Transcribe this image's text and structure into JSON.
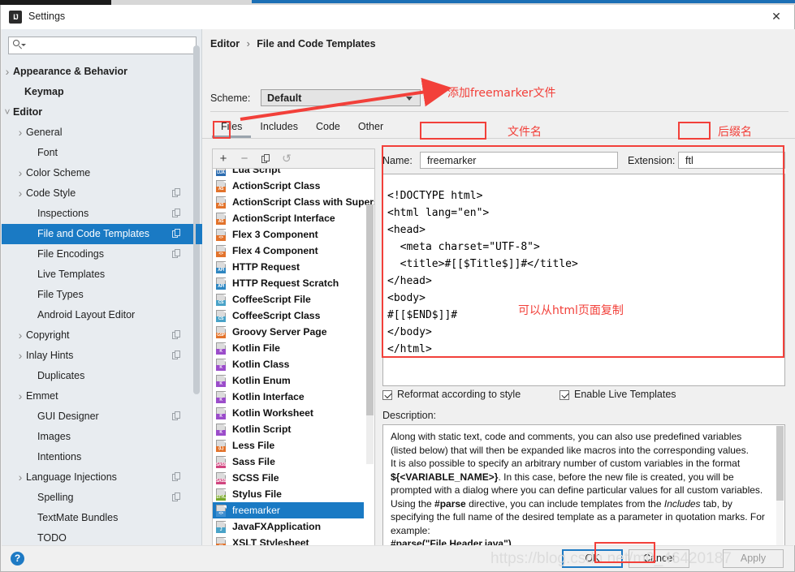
{
  "window": {
    "title": "Settings",
    "app_icon": "intellij-idea-icon",
    "close_icon": "close-icon"
  },
  "sidebar": {
    "search": {
      "placeholder": "",
      "value": "",
      "icon": "search-icon"
    },
    "items": [
      {
        "label": "Appearance & Behavior",
        "arrow": "closed",
        "bold": true,
        "indent": 14,
        "copy": false,
        "selected": false
      },
      {
        "label": "Keymap",
        "arrow": "none",
        "bold": true,
        "indent": 28,
        "copy": false,
        "selected": false
      },
      {
        "label": "Editor",
        "arrow": "open",
        "bold": true,
        "indent": 14,
        "copy": false,
        "selected": false
      },
      {
        "label": "General",
        "arrow": "closed",
        "bold": false,
        "indent": 30,
        "copy": false,
        "selected": false
      },
      {
        "label": "Font",
        "arrow": "none",
        "bold": false,
        "indent": 44,
        "copy": false,
        "selected": false
      },
      {
        "label": "Color Scheme",
        "arrow": "closed",
        "bold": false,
        "indent": 30,
        "copy": false,
        "selected": false
      },
      {
        "label": "Code Style",
        "arrow": "closed",
        "bold": false,
        "indent": 30,
        "copy": true,
        "selected": false
      },
      {
        "label": "Inspections",
        "arrow": "none",
        "bold": false,
        "indent": 44,
        "copy": true,
        "selected": false
      },
      {
        "label": "File and Code Templates",
        "arrow": "none",
        "bold": false,
        "indent": 44,
        "copy": true,
        "selected": true
      },
      {
        "label": "File Encodings",
        "arrow": "none",
        "bold": false,
        "indent": 44,
        "copy": true,
        "selected": false
      },
      {
        "label": "Live Templates",
        "arrow": "none",
        "bold": false,
        "indent": 44,
        "copy": false,
        "selected": false
      },
      {
        "label": "File Types",
        "arrow": "none",
        "bold": false,
        "indent": 44,
        "copy": false,
        "selected": false
      },
      {
        "label": "Android Layout Editor",
        "arrow": "none",
        "bold": false,
        "indent": 44,
        "copy": false,
        "selected": false
      },
      {
        "label": "Copyright",
        "arrow": "closed",
        "bold": false,
        "indent": 30,
        "copy": true,
        "selected": false
      },
      {
        "label": "Inlay Hints",
        "arrow": "closed",
        "bold": false,
        "indent": 30,
        "copy": true,
        "selected": false
      },
      {
        "label": "Duplicates",
        "arrow": "none",
        "bold": false,
        "indent": 44,
        "copy": false,
        "selected": false
      },
      {
        "label": "Emmet",
        "arrow": "closed",
        "bold": false,
        "indent": 30,
        "copy": false,
        "selected": false
      },
      {
        "label": "GUI Designer",
        "arrow": "none",
        "bold": false,
        "indent": 44,
        "copy": true,
        "selected": false
      },
      {
        "label": "Images",
        "arrow": "none",
        "bold": false,
        "indent": 44,
        "copy": false,
        "selected": false
      },
      {
        "label": "Intentions",
        "arrow": "none",
        "bold": false,
        "indent": 44,
        "copy": false,
        "selected": false
      },
      {
        "label": "Language Injections",
        "arrow": "closed",
        "bold": false,
        "indent": 30,
        "copy": true,
        "selected": false
      },
      {
        "label": "Spelling",
        "arrow": "none",
        "bold": false,
        "indent": 44,
        "copy": true,
        "selected": false
      },
      {
        "label": "TextMate Bundles",
        "arrow": "none",
        "bold": false,
        "indent": 44,
        "copy": false,
        "selected": false
      },
      {
        "label": "TODO",
        "arrow": "none",
        "bold": false,
        "indent": 44,
        "copy": false,
        "selected": false
      }
    ]
  },
  "content": {
    "breadcrumb": {
      "root": "Editor",
      "separator": "›",
      "leaf": "File and Code Templates"
    },
    "scheme": {
      "label": "Scheme:",
      "value": "Default",
      "chevron_icon": "chevron-down-icon"
    },
    "tabs": [
      {
        "label": "Files",
        "active": true
      },
      {
        "label": "Includes",
        "active": false
      },
      {
        "label": "Code",
        "active": false
      },
      {
        "label": "Other",
        "active": false
      }
    ],
    "list_toolbar": {
      "add_label": "+",
      "remove_label": "−",
      "copy_icon": "copy-icon",
      "undo_label": "↺"
    },
    "templates": [
      {
        "label": "Lua Script",
        "tag": "LUA",
        "tag_color": "#2b6cb0",
        "selected": false,
        "clipped": true
      },
      {
        "label": "ActionScript Class",
        "tag": "AS",
        "tag_color": "#e2732c",
        "selected": false
      },
      {
        "label": "ActionScript Class with Supers",
        "tag": "AS",
        "tag_color": "#e2732c",
        "selected": false
      },
      {
        "label": "ActionScript Interface",
        "tag": "AS",
        "tag_color": "#e2732c",
        "selected": false
      },
      {
        "label": "Flex 3 Component",
        "tag": "<>",
        "tag_color": "#e2732c",
        "selected": false
      },
      {
        "label": "Flex 4 Component",
        "tag": "<>",
        "tag_color": "#e2732c",
        "selected": false
      },
      {
        "label": "HTTP Request",
        "tag": "API",
        "tag_color": "#2e86c1",
        "selected": false
      },
      {
        "label": "HTTP Request Scratch",
        "tag": "API",
        "tag_color": "#2e86c1",
        "selected": false
      },
      {
        "label": "CoffeeScript File",
        "tag": "CS",
        "tag_color": "#4aa3c8",
        "selected": false
      },
      {
        "label": "CoffeeScript Class",
        "tag": "CS",
        "tag_color": "#4aa3c8",
        "selected": false
      },
      {
        "label": "Groovy Server Page",
        "tag": "GSP",
        "tag_color": "#e2732c",
        "selected": false
      },
      {
        "label": "Kotlin File",
        "tag": "K",
        "tag_color": "#9b4dca",
        "selected": false
      },
      {
        "label": "Kotlin Class",
        "tag": "K",
        "tag_color": "#9b4dca",
        "selected": false
      },
      {
        "label": "Kotlin Enum",
        "tag": "K",
        "tag_color": "#9b4dca",
        "selected": false
      },
      {
        "label": "Kotlin Interface",
        "tag": "K",
        "tag_color": "#9b4dca",
        "selected": false
      },
      {
        "label": "Kotlin Worksheet",
        "tag": "K",
        "tag_color": "#9b4dca",
        "selected": false
      },
      {
        "label": "Kotlin Script",
        "tag": "K",
        "tag_color": "#9b4dca",
        "selected": false
      },
      {
        "label": "Less File",
        "tag": "{L}",
        "tag_color": "#e2732c",
        "selected": false
      },
      {
        "label": "Sass File",
        "tag": "SASS",
        "tag_color": "#d1457f",
        "selected": false
      },
      {
        "label": "SCSS File",
        "tag": "SASS",
        "tag_color": "#d1457f",
        "selected": false
      },
      {
        "label": "Stylus File",
        "tag": "STYL",
        "tag_color": "#7aa82c",
        "selected": false
      },
      {
        "label": "freemarker",
        "tag": "<>",
        "tag_color": "#3f8fd0",
        "selected": true
      },
      {
        "label": "JavaFXApplication",
        "tag": "J",
        "tag_color": "#4aa3c8",
        "selected": false
      },
      {
        "label": "XSLT Stylesheet",
        "tag": "<>",
        "tag_color": "#e2732c",
        "selected": false
      }
    ],
    "name": {
      "label": "Name:",
      "value": "freemarker"
    },
    "extension": {
      "label": "Extension:",
      "value": "ftl"
    },
    "code": "<!DOCTYPE html>\n<html lang=\"en\">\n<head>\n  <meta charset=\"UTF-8\">\n  <title>#[[$Title$]]#</title>\n</head>\n<body>\n#[[$END$]]#\n</body>\n</html>",
    "checkboxes": [
      {
        "label": "Reformat according to style",
        "checked": true
      },
      {
        "label": "Enable Live Templates",
        "checked": true
      }
    ],
    "description_label": "Description:",
    "description": "Along with static text, code and comments, you can also use predefined variables (listed below) that will then be expanded like macros into the corresponding values.\nIt is also possible to specify an arbitrary number of custom variables in the format ${<VARIABLE_NAME>}. In this case, before the new file is created, you will be prompted with a dialog where you can define particular values for all custom variables.\nUsing the #parse directive, you can include templates from the Includes tab, by specifying the full name of the desired template as a parameter in quotation marks. For example:\n#parse(\"File Header.java\")"
  },
  "footer": {
    "help_label": "?",
    "ok_label": "OK",
    "cancel_label": "Cancel",
    "apply_label": "Apply"
  },
  "annotations": [
    {
      "id": "add-freemarker-file",
      "text": "添加freemarker文件"
    },
    {
      "id": "file-name",
      "text": "文件名"
    },
    {
      "id": "suffix-name",
      "text": "后缀名"
    },
    {
      "id": "copy-from-html-page",
      "text": "可以从html页面复制"
    }
  ],
  "watermark": "https://blog.csdn.net/m0_46420187",
  "colors": {
    "accent": "#1a7ac4",
    "annotation": "#f2403a",
    "sidebar_bg": "#e8ecf0",
    "panel_bg": "#f0f0f0"
  }
}
